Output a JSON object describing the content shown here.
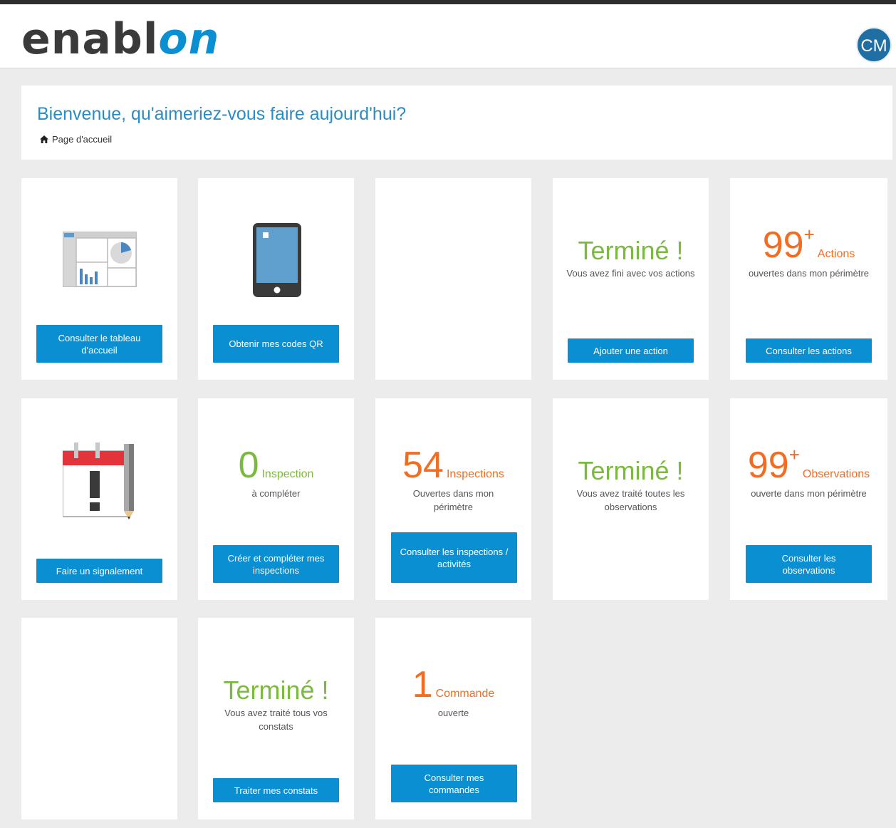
{
  "header": {
    "logo_main": "enabl",
    "logo_accent": "on",
    "avatar_initials": "CM"
  },
  "welcome": {
    "title": "Bienvenue, qu'aimeriez-vous faire aujourd'hui?",
    "breadcrumb": "Page d'accueil"
  },
  "tiles": {
    "dashboard": {
      "icon": "dashboard-icon",
      "button": "Consulter le tableau d'accueil"
    },
    "qr": {
      "icon": "tablet-icon",
      "button": "Obtenir mes codes QR"
    },
    "actions_done": {
      "headline": "Terminé !",
      "text": "Vous avez fini avec vos actions",
      "button": "Ajouter une action"
    },
    "actions_open": {
      "count": "99",
      "plus": "+",
      "unit": "Actions",
      "text": "ouvertes dans mon périmètre",
      "button": "Consulter les actions"
    },
    "report": {
      "icon": "calendar-alert-icon",
      "button": "Faire un signalement"
    },
    "inspection_todo": {
      "count": "0",
      "unit": "Inspection",
      "text": "à compléter",
      "button": "Créer et compléter mes inspections"
    },
    "inspections_open": {
      "count": "54",
      "unit": "Inspections",
      "text": "Ouvertes dans mon périmètre",
      "button": "Consulter les inspections / activités"
    },
    "observations_done": {
      "headline": "Terminé !",
      "text": "Vous avez traité toutes les observations"
    },
    "observations_open": {
      "count": "99",
      "plus": "+",
      "unit": "Observations",
      "text": "ouverte dans mon périmètre",
      "button": "Consulter les observations"
    },
    "findings_done": {
      "headline": "Terminé !",
      "text": "Vous avez traité tous vos constats",
      "button": "Traiter mes constats"
    },
    "orders_open": {
      "count": "1",
      "unit": "Commande",
      "text": "ouverte",
      "button": "Consulter mes commandes"
    }
  },
  "colors": {
    "accent_blue": "#0a8fd3",
    "success_green": "#7cb940",
    "count_orange": "#f26d21",
    "title_blue": "#2b8cc4"
  }
}
